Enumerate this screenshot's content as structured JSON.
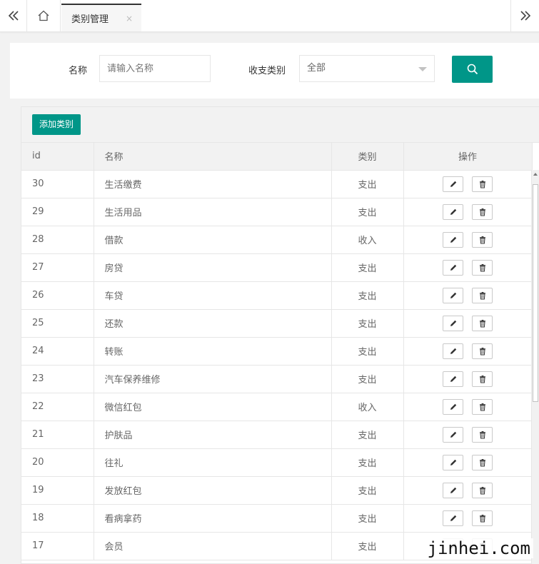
{
  "tabbar": {
    "active_tab": "类别管理",
    "close_glyph": "×"
  },
  "search": {
    "name_label": "名称",
    "name_placeholder": "请输入名称",
    "type_label": "收支类别",
    "type_selected": "全部"
  },
  "toolbar": {
    "add_label": "添加类别"
  },
  "table": {
    "columns": [
      "id",
      "名称",
      "类别",
      "操作"
    ],
    "rows": [
      {
        "id": "30",
        "name": "生活缴费",
        "type": "支出"
      },
      {
        "id": "29",
        "name": "生活用品",
        "type": "支出"
      },
      {
        "id": "28",
        "name": "借款",
        "type": "收入"
      },
      {
        "id": "27",
        "name": "房贷",
        "type": "支出"
      },
      {
        "id": "26",
        "name": "车贷",
        "type": "支出"
      },
      {
        "id": "25",
        "name": "还款",
        "type": "支出"
      },
      {
        "id": "24",
        "name": "转账",
        "type": "支出"
      },
      {
        "id": "23",
        "name": "汽车保养维修",
        "type": "支出"
      },
      {
        "id": "22",
        "name": "微信红包",
        "type": "收入"
      },
      {
        "id": "21",
        "name": "护肤品",
        "type": "支出"
      },
      {
        "id": "20",
        "name": "往礼",
        "type": "支出"
      },
      {
        "id": "19",
        "name": "发放红包",
        "type": "支出"
      },
      {
        "id": "18",
        "name": "看病拿药",
        "type": "支出"
      },
      {
        "id": "17",
        "name": "会员",
        "type": "支出"
      }
    ]
  },
  "watermark": "jinhei.com",
  "colors": {
    "accent": "#009688"
  },
  "icons": {
    "nav_prev": "double-chevron-left-icon",
    "home": "home-icon",
    "nav_next": "double-chevron-right-icon",
    "search": "search-icon",
    "edit": "pencil-icon",
    "delete": "trash-icon"
  }
}
